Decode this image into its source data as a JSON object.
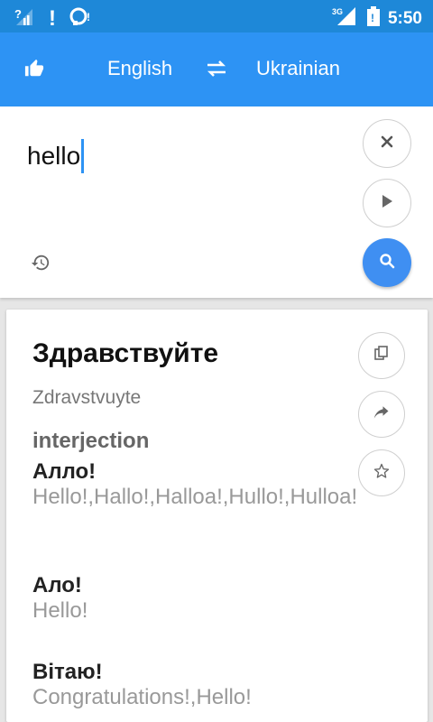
{
  "status_bar": {
    "time": "5:50",
    "network": "3G",
    "icons": [
      "signal-unknown-icon",
      "alert-icon",
      "notification-icon",
      "signal-3g-icon",
      "battery-icon"
    ]
  },
  "app_bar": {
    "source_language": "English",
    "target_language": "Ukrainian",
    "icons": [
      "thumbs-up-icon",
      "swap-icon"
    ]
  },
  "input": {
    "text": "hello",
    "icons": [
      "clear-icon",
      "play-icon",
      "search-icon",
      "history-icon"
    ]
  },
  "result": {
    "translation": "Здравствуйте",
    "transliteration": "Zdravstvuyte",
    "part_of_speech": "interjection",
    "entries": [
      {
        "word": "Алло!",
        "meanings": "Hello!,Hallo!,Halloa!,Hullo!,Hulloa!"
      },
      {
        "word": "Ало!",
        "meanings": "Hello!"
      },
      {
        "word": "Вітаю!",
        "meanings": "Congratulations!,Hello!"
      }
    ],
    "icons": [
      "copy-icon",
      "share-icon",
      "star-icon"
    ]
  },
  "colors": {
    "status_bar": "#1e88d8",
    "app_bar": "#2d93f4",
    "search_button": "#3f8ff2"
  }
}
